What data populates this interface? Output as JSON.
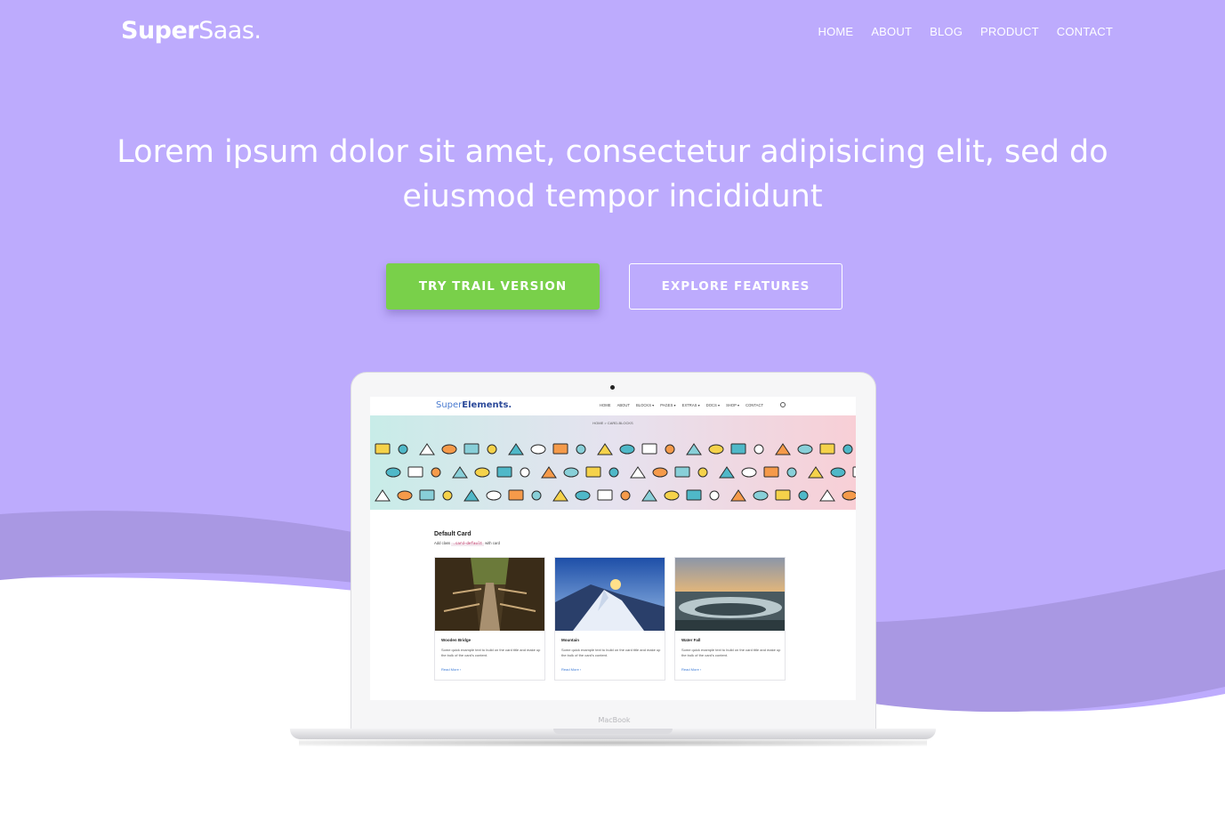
{
  "brand": {
    "bold": "Super",
    "light": "Saas."
  },
  "nav": {
    "items": [
      "HOME",
      "ABOUT",
      "BLOG",
      "PRODUCT",
      "CONTACT"
    ]
  },
  "hero": {
    "headline_line1": "Lorem ipsum dolor sit amet, consectetur adipisicing elit, sed do",
    "headline_line2": "eiusmod tempor incididunt",
    "primary_cta": "TRY TRAIL VERSION",
    "secondary_cta": "EXPLORE FEATURES"
  },
  "colors": {
    "hero_bg": "#bdabfd",
    "wave_dark": "#a998e3",
    "primary_button": "#79d04a",
    "text": "#ffffff"
  },
  "laptop": {
    "label": "MacBook",
    "site": {
      "logo_regular": "Super",
      "logo_bold": "Elements.",
      "menu": [
        "HOME",
        "ABOUT",
        "BLOCKS ▾",
        "PAGES ▾",
        "EXTRAS ▾",
        "DOCS ▾",
        "SHOP ▾",
        "CONTACT"
      ],
      "breadcrumb": "HOME  >  CARD-BLOCKS",
      "section_title": "Default Card",
      "section_sub_prefix": "Add class",
      "section_sub_code": ".card-default",
      "section_sub_suffix": "with card",
      "cards": [
        {
          "title": "Wooden Bridge",
          "text": "Some quick example text to build on the card title and make up the bulk of the card's content.",
          "link": "Read More ›"
        },
        {
          "title": "Mountain",
          "text": "Some quick example text to build on the card title and make up the bulk of the card's content.",
          "link": "Read More ›"
        },
        {
          "title": "Water Fall",
          "text": "Some quick example text to build on the card title and make up the bulk of the card's content.",
          "link": "Read More ›"
        }
      ]
    }
  }
}
